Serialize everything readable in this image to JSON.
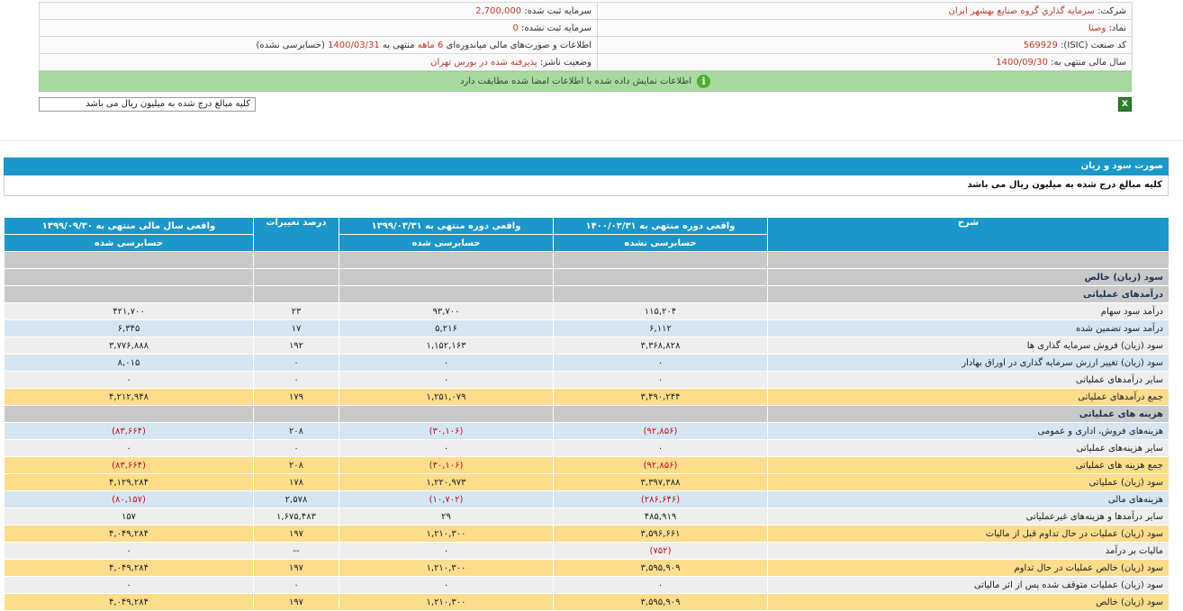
{
  "info": {
    "company_label": "شرکت:",
    "company_value": "سرمايه گذاري گروه صنايع بهشهر ايران",
    "capital_registered_label": "سرمایه ثبت شده:",
    "capital_registered_value": "2,700,000",
    "symbol_label": "نماد:",
    "symbol_value": "وصنا",
    "capital_unregistered_label": "سرمایه ثبت نشده:",
    "capital_unregistered_value": "0",
    "isic_label": "کد صنعت (ISIC):",
    "isic_value": "569929",
    "report_prefix": "اطلاعات و صورت‌های مالی میاندوره‌ای",
    "report_period": "6 ماهه",
    "report_mid": "منتهی به",
    "report_date": "1400/03/31",
    "report_status": "(حسابرسی نشده)",
    "fiscal_year_label": "سال مالی منتهی به:",
    "fiscal_year_value": "1400/09/30",
    "publisher_status_label": "وضعیت ناشر:",
    "publisher_status_value": "پذیرفته شده در بورس تهران"
  },
  "verify_message": "اطلاعات نمایش داده شده با اطلاعات امضا شده مطابقت دارد",
  "note_box": "کلیه مبالغ درج شده به میلیون ریال می باشد",
  "icons": {
    "info": "info-icon",
    "excel": "excel-export-icon"
  },
  "section": {
    "title": "صورت سود و زیان",
    "subtitle": "کلیه مبالغ درج شده به میلیون ریال می باشد"
  },
  "table": {
    "headers": {
      "desc": "شرح",
      "col1_title": "واقعی دوره منتهی به ۱۴۰۰/۰۳/۳۱",
      "col1_status": "حسابرسی نشده",
      "col2_title": "واقعی دوره منتهی به ۱۳۹۹/۰۳/۳۱",
      "col2_status": "حسابرسی شده",
      "col3_title": "درصد تغییرات",
      "col4_title": "واقعی سال مالی منتهی به ۱۳۹۹/۰۹/۳۰",
      "col4_status": "حسابرسی شده"
    },
    "rows": [
      {
        "desc": "",
        "c1": "",
        "c2": "",
        "c3": "",
        "c4": "",
        "kind": "blank"
      },
      {
        "desc": "سود (زیان) خالص",
        "c1": "",
        "c2": "",
        "c3": "",
        "c4": "",
        "kind": "section"
      },
      {
        "desc": "درآمدهای عملیاتی",
        "c1": "",
        "c2": "",
        "c3": "",
        "c4": "",
        "kind": "section"
      },
      {
        "desc": "درآمد سود سهام",
        "c1": "۱۱۵,۲۰۴",
        "c2": "۹۳,۷۰۰",
        "c3": "۲۳",
        "c4": "۴۲۱,۷۰۰",
        "kind": "plain"
      },
      {
        "desc": "درآمد سود تضمین شده",
        "c1": "۶,۱۱۲",
        "c2": "۵,۲۱۶",
        "c3": "۱۷",
        "c4": "۶,۳۴۵",
        "kind": "blue"
      },
      {
        "desc": "سود (زیان) فروش سرمایه گذاری ها",
        "c1": "۳,۳۶۸,۸۲۸",
        "c2": "۱,۱۵۲,۱۶۳",
        "c3": "۱۹۲",
        "c4": "۳,۷۷۶,۸۸۸",
        "kind": "plain"
      },
      {
        "desc": "سود (زیان) تغییر ارزش سرمایه گذاری در اوراق بهادار",
        "c1": "۰",
        "c2": "۰",
        "c3": "۰",
        "c4": "۸,۰۱۵",
        "kind": "blue"
      },
      {
        "desc": "سایر درآمدهای عملیاتی",
        "c1": "۰",
        "c2": "۰",
        "c3": "۰",
        "c4": "۰",
        "kind": "plain"
      },
      {
        "desc": "جمع درآمدهای عملیاتی",
        "c1": "۳,۴۹۰,۲۴۴",
        "c2": "۱,۲۵۱,۰۷۹",
        "c3": "۱۷۹",
        "c4": "۴,۲۱۲,۹۴۸",
        "kind": "total"
      },
      {
        "desc": "هزینه های عملیاتی",
        "c1": "",
        "c2": "",
        "c3": "",
        "c4": "",
        "kind": "section"
      },
      {
        "desc": "هزینه‌های فروش، اداری و عمومی",
        "c1": "(۹۲,۸۵۶)",
        "c2": "(۳۰,۱۰۶)",
        "c3": "۲۰۸",
        "c4": "(۸۳,۶۶۴)",
        "kind": "blue"
      },
      {
        "desc": "سایر هزینه‌های عملیاتی",
        "c1": "۰",
        "c2": "۰",
        "c3": "۰",
        "c4": "۰",
        "kind": "plain"
      },
      {
        "desc": "جمع هزینه های عملیاتی",
        "c1": "(۹۲,۸۵۶)",
        "c2": "(۳۰,۱۰۶)",
        "c3": "۲۰۸",
        "c4": "(۸۳,۶۶۴)",
        "kind": "total"
      },
      {
        "desc": "سود (زیان) عملیاتی",
        "c1": "۳,۳۹۷,۳۸۸",
        "c2": "۱,۲۲۰,۹۷۳",
        "c3": "۱۷۸",
        "c4": "۴,۱۲۹,۲۸۴",
        "kind": "total"
      },
      {
        "desc": "هزینه‌های مالی",
        "c1": "(۲۸۶,۶۴۶)",
        "c2": "(۱۰,۷۰۲)",
        "c3": "۲,۵۷۸",
        "c4": "(۸۰,۱۵۷)",
        "kind": "blue"
      },
      {
        "desc": "سایر درآمدها و هزینه‌های غیرعملیاتی",
        "c1": "۴۸۵,۹۱۹",
        "c2": "۲۹",
        "c3": "۱,۶۷۵,۴۸۳",
        "c4": "۱۵۷",
        "kind": "plain"
      },
      {
        "desc": "سود (زیان) عملیات در حال تداوم قبل از مالیات",
        "c1": "۳,۵۹۶,۶۶۱",
        "c2": "۱,۲۱۰,۳۰۰",
        "c3": "۱۹۷",
        "c4": "۴,۰۴۹,۲۸۴",
        "kind": "total"
      },
      {
        "desc": "مالیات بر درآمد",
        "c1": "(۷۵۲)",
        "c2": "۰",
        "c3": "--",
        "c4": "۰",
        "kind": "plain"
      },
      {
        "desc": "سود (زیان) خالص عملیات در حال تداوم",
        "c1": "۳,۵۹۵,۹۰۹",
        "c2": "۱,۲۱۰,۳۰۰",
        "c3": "۱۹۷",
        "c4": "۴,۰۴۹,۲۸۴",
        "kind": "total"
      },
      {
        "desc": "سود (زیان) عملیات متوقف شده پس از اثر مالیاتی",
        "c1": "۰",
        "c2": "۰",
        "c3": "۰",
        "c4": "۰",
        "kind": "plain"
      },
      {
        "desc": "سود (زیان) خالص",
        "c1": "۳,۵۹۵,۹۰۹",
        "c2": "۱,۲۱۰,۳۰۰",
        "c3": "۱۹۷",
        "c4": "۴,۰۴۹,۲۸۴",
        "kind": "total"
      }
    ]
  }
}
